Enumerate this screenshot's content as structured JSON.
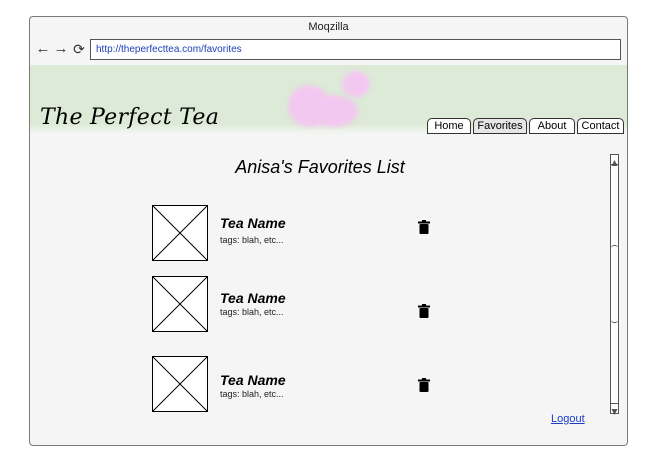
{
  "browser": {
    "title": "Moqzilla",
    "url": "http://theperfecttea.com/favorites"
  },
  "site": {
    "logo": "The Perfect Tea",
    "tabs": [
      {
        "label": "Home"
      },
      {
        "label": "Favorites"
      },
      {
        "label": "About"
      },
      {
        "label": "Contact"
      }
    ]
  },
  "page": {
    "title": "Anisa's Favorites List",
    "items": [
      {
        "name": "Tea Name",
        "tags": "tags: blah, etc..."
      },
      {
        "name": "Tea Name",
        "tags": "tags: blah, etc..."
      },
      {
        "name": "Tea Name",
        "tags": "tags: blah, etc..."
      }
    ],
    "logout": "Logout"
  },
  "colors": {
    "banner": "#dcead7",
    "link": "#1a3cc7",
    "accent_blob": "#f3c8f0"
  }
}
